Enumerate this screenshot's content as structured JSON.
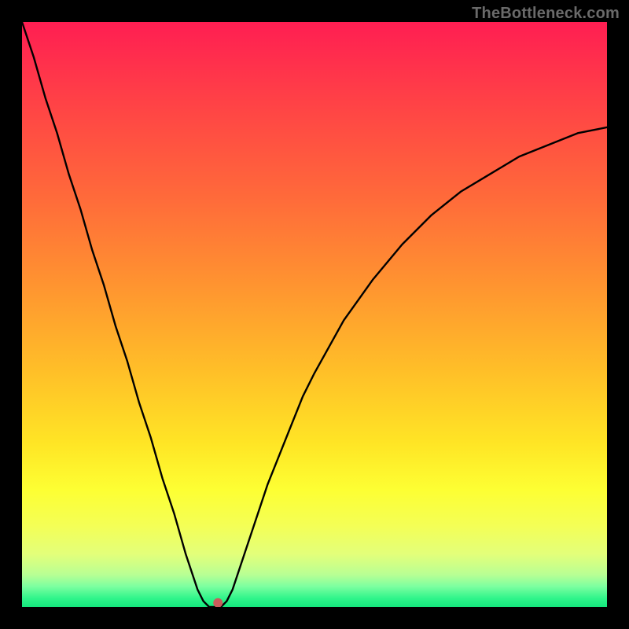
{
  "watermark": {
    "text": "TheBottleneck.com"
  },
  "chart_data": {
    "type": "line",
    "title": "",
    "xlabel": "",
    "ylabel": "",
    "xlim": [
      0,
      100
    ],
    "ylim": [
      0,
      100
    ],
    "grid": false,
    "series": [
      {
        "name": "bottleneck-curve",
        "x": [
          0,
          2,
          4,
          6,
          8,
          10,
          12,
          14,
          16,
          18,
          20,
          22,
          24,
          26,
          28,
          30,
          31,
          32,
          33,
          34,
          35,
          36,
          38,
          40,
          42,
          44,
          46,
          48,
          50,
          55,
          60,
          65,
          70,
          75,
          80,
          85,
          90,
          95,
          100
        ],
        "y": [
          100,
          94,
          87,
          81,
          74,
          68,
          61,
          55,
          48,
          42,
          35,
          29,
          22,
          16,
          9,
          3,
          1,
          0,
          0,
          0,
          1,
          3,
          9,
          15,
          21,
          26,
          31,
          36,
          40,
          49,
          56,
          62,
          67,
          71,
          74,
          77,
          79,
          81,
          82
        ]
      }
    ],
    "marker": {
      "x": 33.5,
      "y": 0.7,
      "color": "#c95c5c",
      "radius_px": 6
    },
    "background_gradient": {
      "stops": [
        {
          "offset": 0.0,
          "color": "#ff1e52"
        },
        {
          "offset": 0.15,
          "color": "#ff4545"
        },
        {
          "offset": 0.3,
          "color": "#ff6a3a"
        },
        {
          "offset": 0.45,
          "color": "#ff9430"
        },
        {
          "offset": 0.6,
          "color": "#ffc028"
        },
        {
          "offset": 0.72,
          "color": "#ffe525"
        },
        {
          "offset": 0.8,
          "color": "#fdff33"
        },
        {
          "offset": 0.86,
          "color": "#f4ff55"
        },
        {
          "offset": 0.91,
          "color": "#e3ff7a"
        },
        {
          "offset": 0.945,
          "color": "#b8ff94"
        },
        {
          "offset": 0.965,
          "color": "#7cffa0"
        },
        {
          "offset": 0.985,
          "color": "#30f58b"
        },
        {
          "offset": 1.0,
          "color": "#14e77d"
        }
      ]
    }
  }
}
